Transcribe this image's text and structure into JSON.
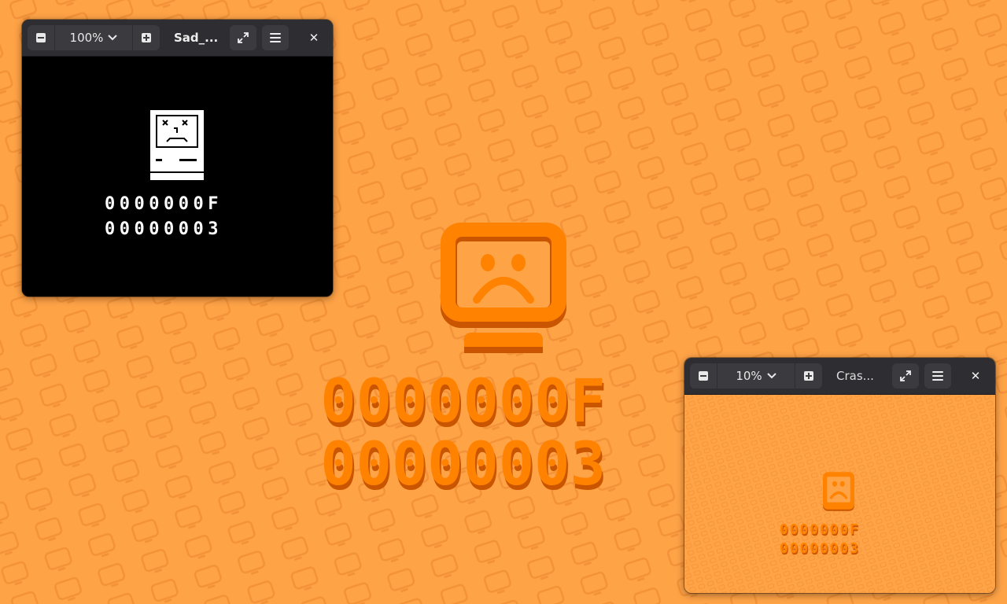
{
  "desktop": {
    "background_color": "#ffa347",
    "pattern_icon": "monitor-icon",
    "sad_icon": "sad-computer-icon",
    "code_line_1": "0000000F",
    "code_line_2": "00000003",
    "accent_color": "#ff8200",
    "shadow_color": "#c95500"
  },
  "window_main": {
    "zoom_out_icon": "zoom-out-icon",
    "zoom_level": "100%",
    "zoom_dropdown_icon": "chevron-down-icon",
    "zoom_in_icon": "zoom-in-icon",
    "title": "Sad_...",
    "fullscreen_icon": "fullscreen-icon",
    "menu_icon": "hamburger-menu-icon",
    "close_icon": "close-icon",
    "image": {
      "icon": "sad-mac-icon",
      "code_line_1": "0000000F",
      "code_line_2": "00000003",
      "background": "#000000"
    }
  },
  "window_secondary": {
    "zoom_out_icon": "zoom-out-icon",
    "zoom_level": "10%",
    "zoom_dropdown_icon": "chevron-down-icon",
    "zoom_in_icon": "zoom-in-icon",
    "title": "Cras...",
    "fullscreen_icon": "fullscreen-icon",
    "menu_icon": "hamburger-menu-icon",
    "close_icon": "close-icon",
    "image": {
      "icon": "sad-computer-icon",
      "code_line_1": "0000000F",
      "code_line_2": "00000003"
    }
  }
}
